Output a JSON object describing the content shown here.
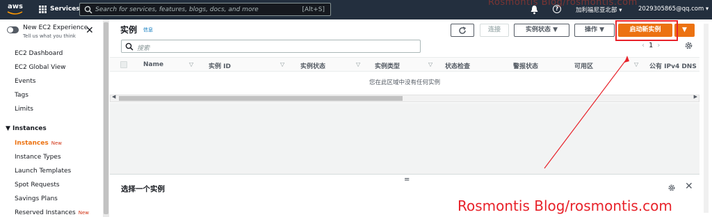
{
  "top_nav": {
    "logo": "aws",
    "services_label": "Services",
    "search_placeholder": "Search for services, features, blogs, docs, and more",
    "search_shortcut": "[Alt+S]",
    "region": "加利福尼亚北部 ▾",
    "account": "2029305865@qq.com ▾",
    "overlay_text": "Rosmontis Blog/rosmontis.com",
    "icons": [
      "grid-icon",
      "search-icon",
      "bell-icon",
      "help-icon"
    ]
  },
  "sidebar": {
    "experience_title": "New EC2 Experience",
    "experience_subtitle": "Tell us what you think",
    "items": [
      {
        "label": "EC2 Dashboard"
      },
      {
        "label": "EC2 Global View"
      },
      {
        "label": "Events"
      },
      {
        "label": "Tags"
      },
      {
        "label": "Limits"
      }
    ],
    "section_label": "▼  Instances",
    "instance_items": [
      {
        "label": "Instances",
        "badge": "New",
        "active": true
      },
      {
        "label": "Instance Types"
      },
      {
        "label": "Launch Templates"
      },
      {
        "label": "Spot Requests"
      },
      {
        "label": "Savings Plans"
      },
      {
        "label": "Reserved Instances",
        "badge": "New"
      }
    ]
  },
  "main": {
    "title": "实例",
    "info": "信息",
    "refresh_icon": "refresh-icon",
    "connect_label": "连接",
    "instance_state_label": "实例状态  ▼",
    "actions_label": "操作  ▼",
    "launch_label": "启动新实例",
    "launch_dropdown": "▼",
    "filter_placeholder": "搜索",
    "page_number": "1",
    "columns": [
      "Name",
      "实例 ID",
      "实例状态",
      "实例类型",
      "状态检查",
      "警报状态",
      "可用区",
      "公有 IPv4 DNS"
    ],
    "empty_message": "您在此区域中没有任何实例"
  },
  "split_panel": {
    "drag_handle": "=",
    "title": "选择一个实例"
  },
  "watermark": "Rosmontis  Blog/rosmontis.com",
  "colors": {
    "nav_bg": "#232f3e",
    "accent_orange": "#ec7211",
    "highlight_red": "#e8222a",
    "link_blue": "#0073bb"
  }
}
